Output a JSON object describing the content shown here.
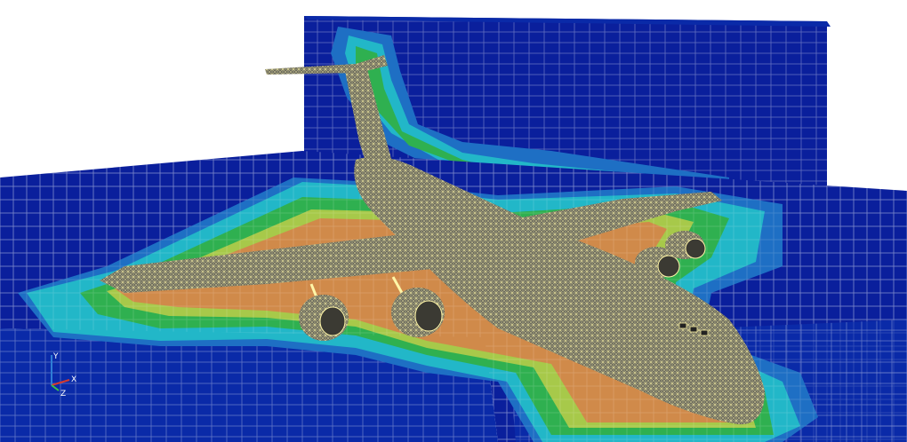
{
  "scene": {
    "subject": "aircraft-surface-mesh",
    "mesh_colors": {
      "background": "#ffffff",
      "far_field": "#0a1f9c",
      "level_1": "#1e6fc4",
      "level_2": "#22b7c8",
      "level_3": "#2fb050",
      "level_4": "#a7c94a",
      "level_5": "#d08a4a",
      "aircraft_wire": "#fff6a8",
      "aircraft_fill": "#6b6a5e"
    }
  },
  "axes_triad": {
    "y_label": "Y",
    "z_label": "Z",
    "x_label": "X"
  }
}
